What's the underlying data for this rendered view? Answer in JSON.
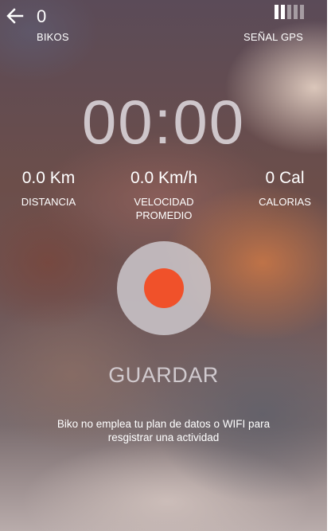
{
  "header": {
    "bikos_count": "0",
    "bikos_label": "BIKOS",
    "gps_label": "SEÑAL GPS",
    "gps_signal_strength": 0.4
  },
  "timer": {
    "value": "00:00"
  },
  "stats": {
    "distance": {
      "value": "0.0 Km",
      "label": "DISTANCIA"
    },
    "speed": {
      "value": "0.0 Km/h",
      "label_line1": "VELOCIDAD",
      "label_line2": "PROMEDIO"
    },
    "calories": {
      "value": "0 Cal",
      "label": "CALORIAS"
    }
  },
  "actions": {
    "save_label": "GUARDAR"
  },
  "note": {
    "line1": "Biko no emplea tu plan de datos o WIFI para",
    "line2": "resgistrar una actividad"
  },
  "colors": {
    "record_accent": "#f0512a",
    "record_button_bg": "#cdc8cd"
  }
}
